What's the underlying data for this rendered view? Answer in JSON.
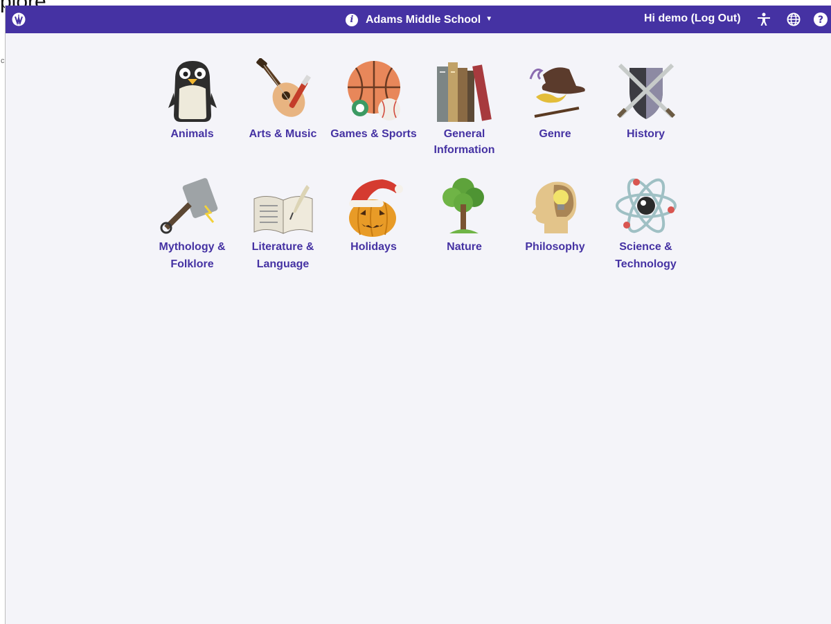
{
  "background_text": {
    "large": "plore",
    "small": "c"
  },
  "header": {
    "school_name": "Adams Middle School",
    "greeting": "Hi demo (Log Out)",
    "icons": [
      "world-book-logo-icon",
      "info-icon",
      "dropdown-caret-icon",
      "accessibility-icon",
      "globe-icon",
      "help-icon"
    ]
  },
  "colors": {
    "header_bg": "#4532a3",
    "link": "#4532a3",
    "page_bg": "#f4f4f9"
  },
  "categories": {
    "animals": {
      "label": "Animals",
      "icon": "penguin-icon"
    },
    "arts": {
      "label": "Arts & Music",
      "icon": "guitar-paintbrush-icon"
    },
    "games": {
      "label": "Games & Sports",
      "icon": "sports-balls-icon"
    },
    "general_1": {
      "label": "General",
      "icon": "books-icon"
    },
    "general_2": {
      "label": "Information"
    },
    "genre": {
      "label": "Genre",
      "icon": "hat-lamp-wand-icon"
    },
    "history": {
      "label": "History",
      "icon": "shield-swords-icon"
    },
    "myth_1": {
      "label": "Mythology &",
      "icon": "hammer-icon"
    },
    "myth_2": {
      "label": "Folklore"
    },
    "lit_1": {
      "label": "Literature &",
      "icon": "open-book-quill-icon"
    },
    "lit_2": {
      "label": "Language"
    },
    "holidays": {
      "label": "Holidays",
      "icon": "pumpkin-santa-hat-icon"
    },
    "nature": {
      "label": "Nature",
      "icon": "tree-icon"
    },
    "philosophy": {
      "label": "Philosophy",
      "icon": "head-lightbulb-icon"
    },
    "science_1": {
      "label": "Science &",
      "icon": "atom-icon"
    },
    "science_2": {
      "label": "Technology"
    }
  }
}
